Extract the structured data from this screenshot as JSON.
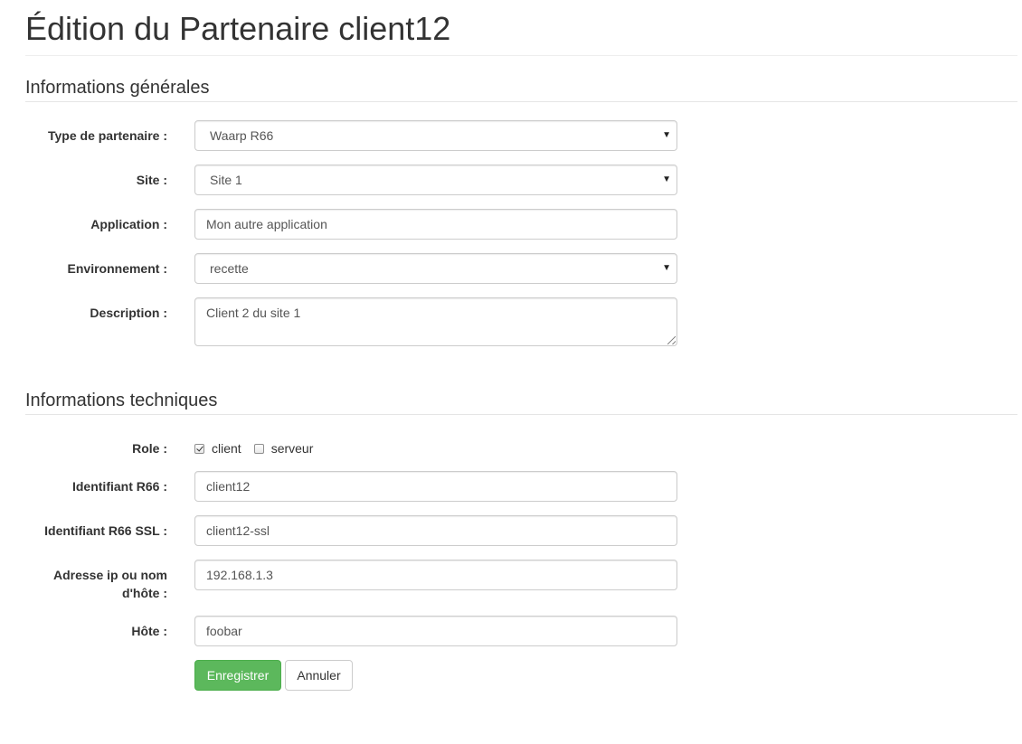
{
  "page": {
    "title": "Édition du Partenaire client12"
  },
  "general_section": {
    "title": "Informations générales",
    "type": {
      "label": "Type de partenaire :",
      "value": "Waarp R66"
    },
    "site": {
      "label": "Site :",
      "value": "Site 1"
    },
    "application": {
      "label": "Application :",
      "value": "Mon autre application"
    },
    "environment": {
      "label": "Environnement :",
      "value": "recette"
    },
    "description": {
      "label": "Description :",
      "value": "Client 2 du site 1"
    }
  },
  "technical_section": {
    "title": "Informations techniques",
    "role": {
      "label": "Role :",
      "options": [
        {
          "label": "client",
          "checked": true
        },
        {
          "label": "serveur",
          "checked": false
        }
      ]
    },
    "r66_id": {
      "label": "Identifiant R66 :",
      "value": "client12"
    },
    "r66_ssl_id": {
      "label": "Identifiant R66 SSL :",
      "value": "client12-ssl"
    },
    "address": {
      "label_line1": "Adresse ip ou nom",
      "label_line2": "d'hôte :",
      "value": "192.168.1.3"
    },
    "host": {
      "label": "Hôte :",
      "value": "foobar"
    }
  },
  "actions": {
    "save_label": "Enregistrer",
    "cancel_label": "Annuler"
  },
  "icons": {
    "select_caret": "▼"
  },
  "colors": {
    "success": "#5cb85c",
    "border": "#cccccc",
    "text": "#333333"
  }
}
